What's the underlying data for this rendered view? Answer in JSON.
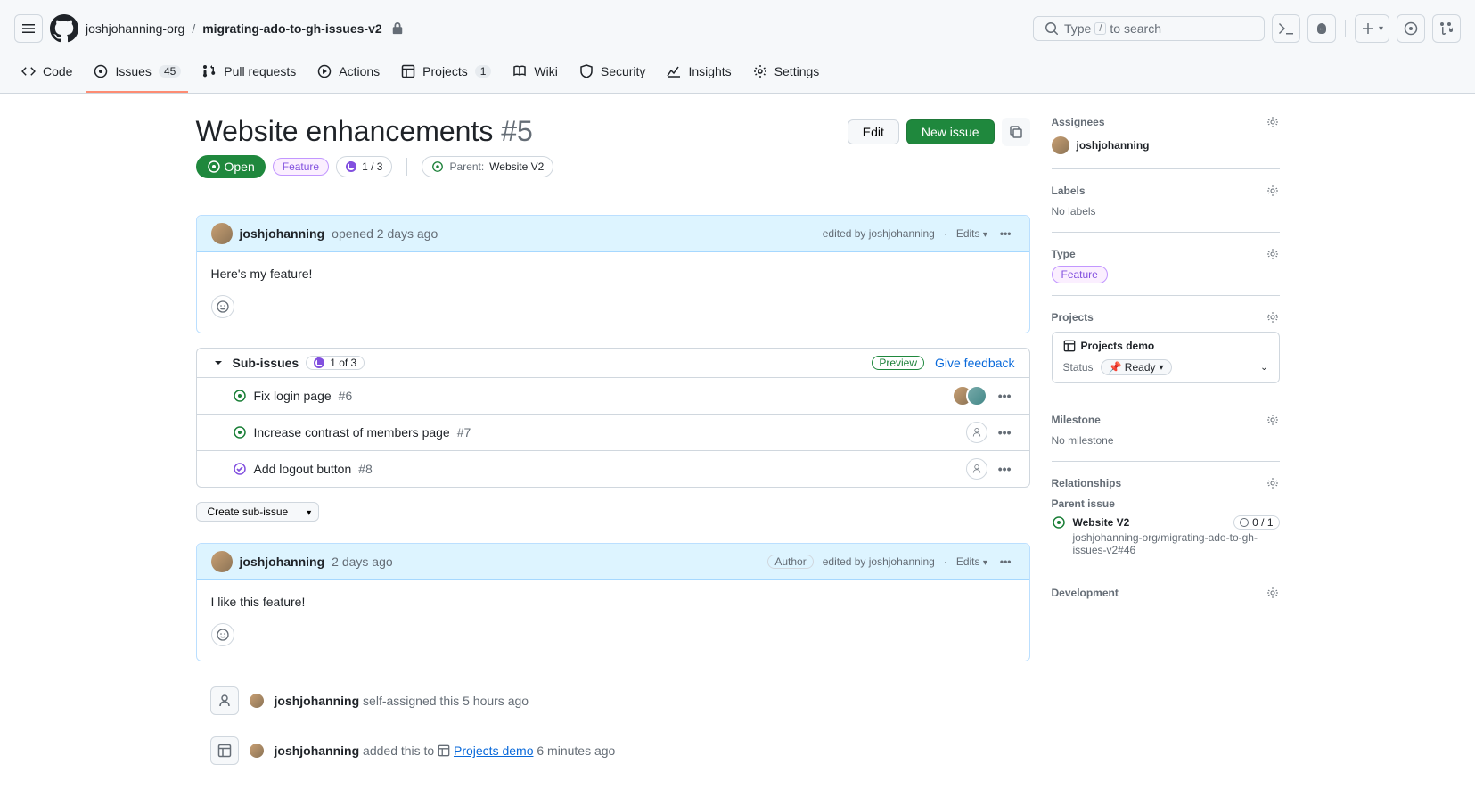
{
  "header": {
    "org": "joshjohanning-org",
    "repo": "migrating-ado-to-gh-issues-v2",
    "search_prefix": "Type",
    "search_key": "/",
    "search_suffix": "to search"
  },
  "nav": {
    "code": "Code",
    "issues": "Issues",
    "issues_count": "45",
    "pulls": "Pull requests",
    "actions": "Actions",
    "projects": "Projects",
    "projects_count": "1",
    "wiki": "Wiki",
    "security": "Security",
    "insights": "Insights",
    "settings": "Settings"
  },
  "issue": {
    "title": "Website enhancements",
    "number": "#5",
    "edit": "Edit",
    "new": "New issue",
    "state": "Open",
    "feature_label": "Feature",
    "progress": "1 / 3",
    "parent_prefix": "Parent:",
    "parent_name": "Website V2"
  },
  "comment1": {
    "author": "joshjohanning",
    "opened": "opened 2 days ago",
    "edited": "edited by joshjohanning",
    "edits": "Edits",
    "body": "Here's my feature!"
  },
  "subissues": {
    "title": "Sub-issues",
    "count": "1 of 3",
    "preview": "Preview",
    "feedback": "Give feedback",
    "items": [
      {
        "title": "Fix login page",
        "num": "#6",
        "status": "open",
        "assignees": "stack"
      },
      {
        "title": "Increase contrast of members page",
        "num": "#7",
        "status": "open",
        "assignees": "blank"
      },
      {
        "title": "Add logout button",
        "num": "#8",
        "status": "done",
        "assignees": "blank"
      }
    ],
    "create": "Create sub-issue"
  },
  "comment2": {
    "author": "joshjohanning",
    "time": "2 days ago",
    "author_badge": "Author",
    "edited": "edited by joshjohanning",
    "edits": "Edits",
    "body": "I like this feature!"
  },
  "events": {
    "e1_user": "joshjohanning",
    "e1_text": "self-assigned this 5 hours ago",
    "e2_user": "joshjohanning",
    "e2_prefix": "added this to",
    "e2_link": "Projects demo",
    "e2_suffix": "6 minutes ago"
  },
  "sidebar": {
    "assignees": "Assignees",
    "assignee_name": "joshjohanning",
    "labels": "Labels",
    "no_labels": "No labels",
    "type": "Type",
    "type_val": "Feature",
    "projects": "Projects",
    "project_name": "Projects demo",
    "status_label": "Status",
    "status_val": "📌 Ready",
    "milestone": "Milestone",
    "no_milestone": "No milestone",
    "relationships": "Relationships",
    "parent_issue": "Parent issue",
    "parent_name": "Website V2",
    "parent_count": "0 / 1",
    "parent_ref": "joshjohanning-org/migrating-ado-to-gh-issues-v2#46",
    "development": "Development"
  }
}
